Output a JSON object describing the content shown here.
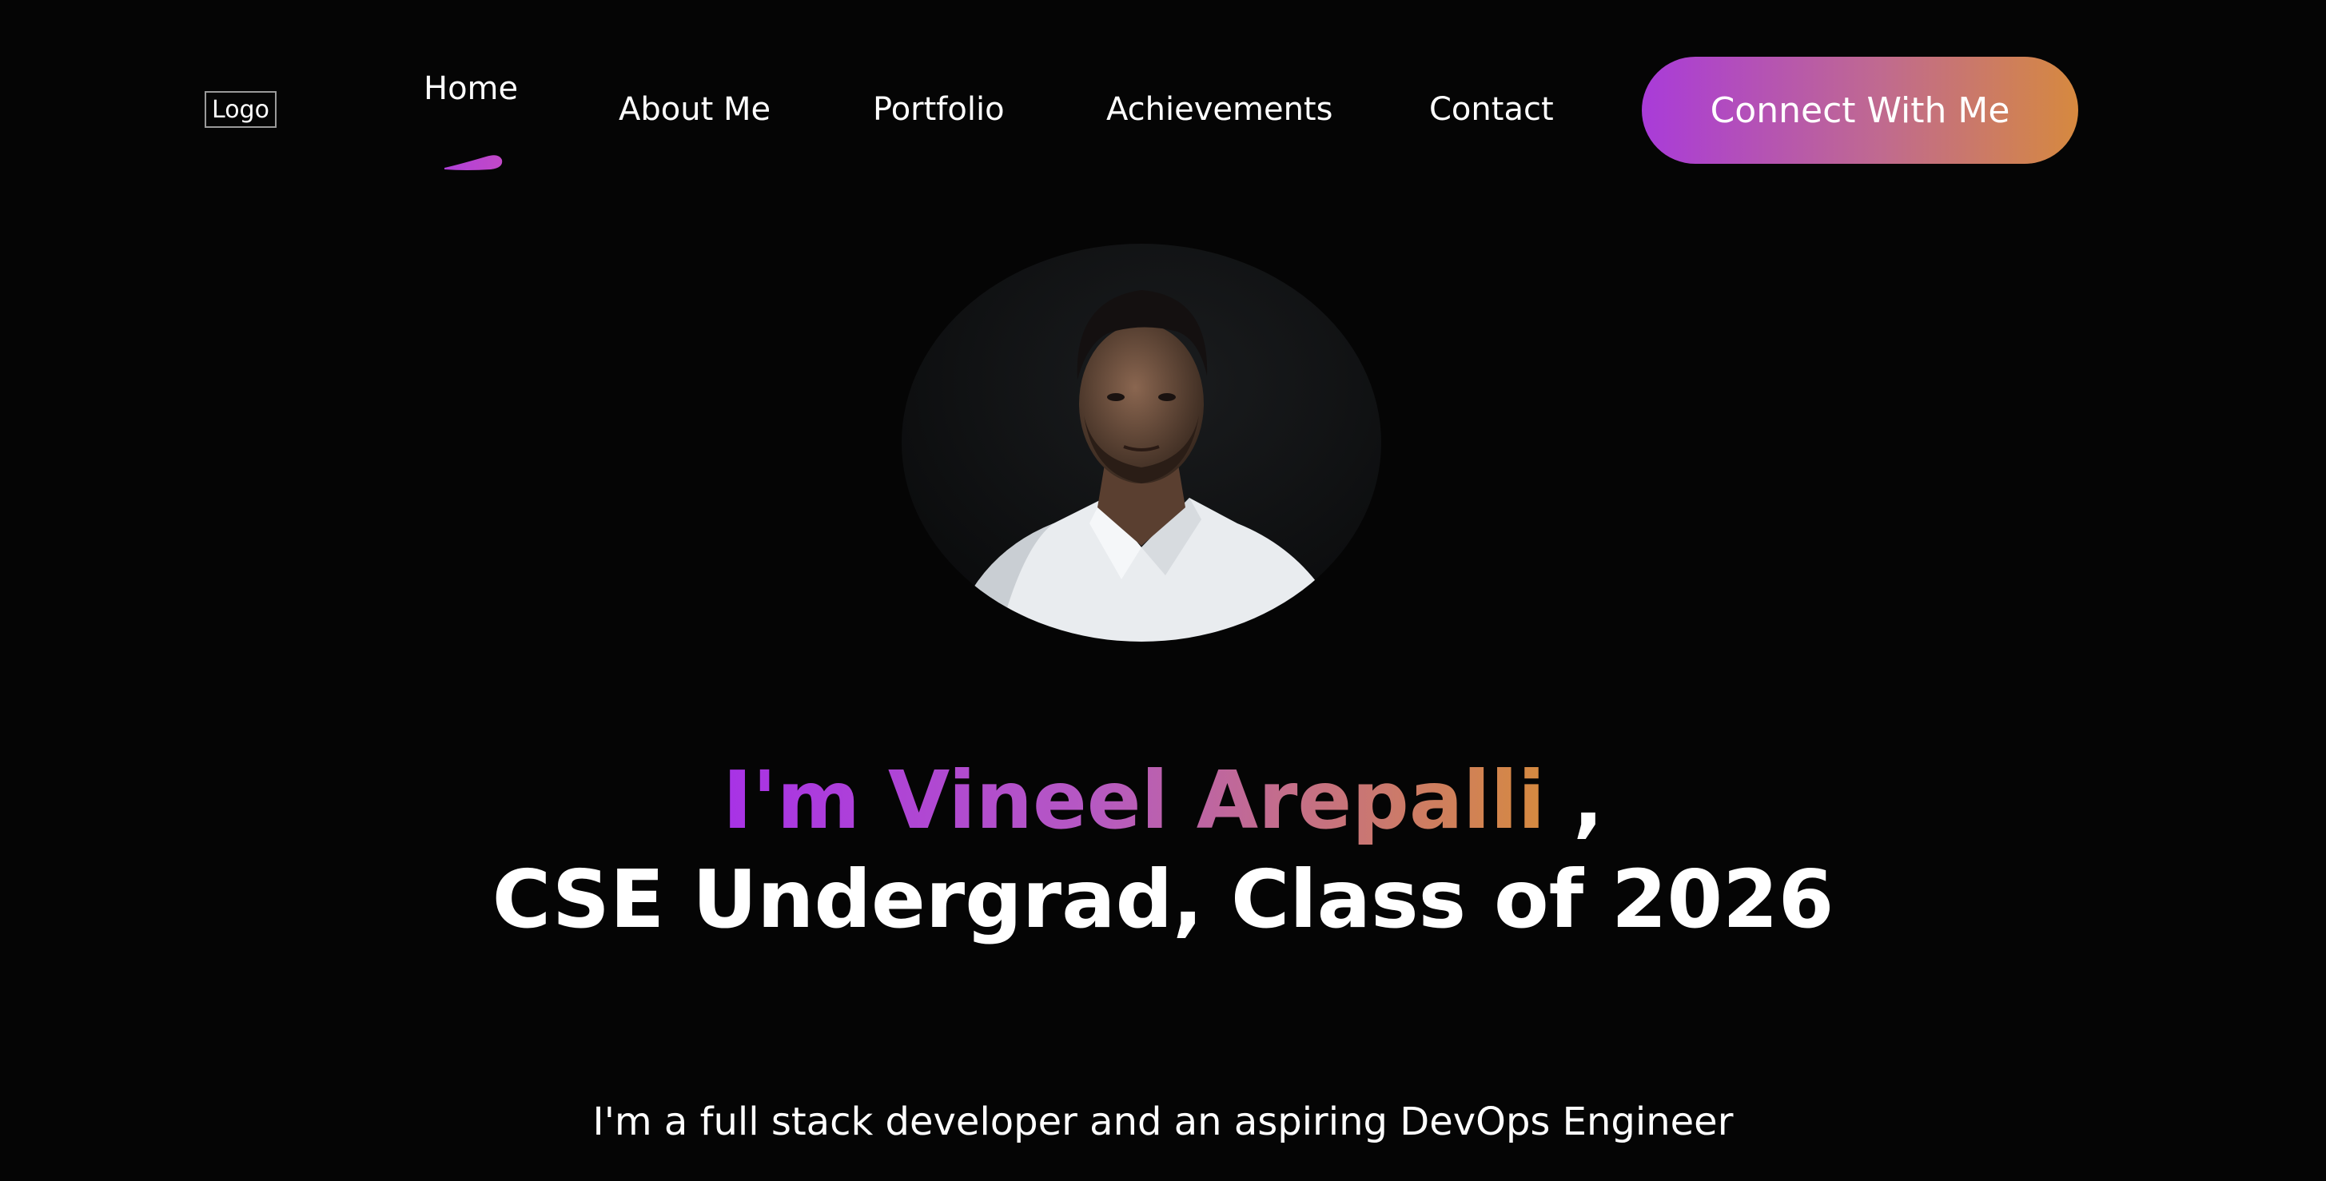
{
  "header": {
    "logo_text": "Logo",
    "nav": {
      "home": "Home",
      "about": "About Me",
      "portfolio": "Portfolio",
      "achievements": "Achievements",
      "contact": "Contact"
    },
    "active_nav": "Home",
    "cta_label": "Connect With Me"
  },
  "hero": {
    "name": "I'm Vineel Arepalli",
    "comma": ",",
    "role": "CSE Undergrad, Class of 2026",
    "tagline": "I'm a full stack developer and an aspiring DevOps Engineer"
  },
  "colors": {
    "background": "#050505",
    "accent_purple": "#a832e6",
    "accent_orange": "#d68a3f",
    "text": "#ffffff"
  }
}
